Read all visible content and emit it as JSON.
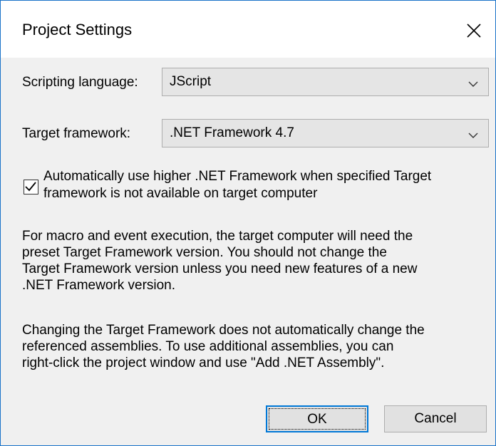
{
  "window": {
    "title": "Project Settings",
    "close_icon": "close-icon"
  },
  "scripting": {
    "label": "Scripting language:",
    "value": "JScript"
  },
  "framework": {
    "label": "Target framework:",
    "value": ".NET Framework 4.7"
  },
  "auto_higher": {
    "checked": true,
    "line1": "Automatically use higher .NET Framework when specified Target",
    "line2": "framework is not available on target computer"
  },
  "info1": {
    "line1": "For macro and event execution, the target computer will need the",
    "line2": "preset Target Framework version. You should not change the",
    "line3": "Target Framework version unless you need new features of a new",
    "line4": ".NET Framework version."
  },
  "info2": {
    "line1": "Changing the Target Framework does not automatically change the",
    "line2": "referenced assemblies. To use additional assemblies, you can",
    "line3": "right-click the project window and use \"Add .NET Assembly\"."
  },
  "buttons": {
    "ok": "OK",
    "cancel": "Cancel"
  },
  "colors": {
    "accent": "#0078d7",
    "window_border": "#1a73c9",
    "client_bg": "#f0f0f0"
  }
}
